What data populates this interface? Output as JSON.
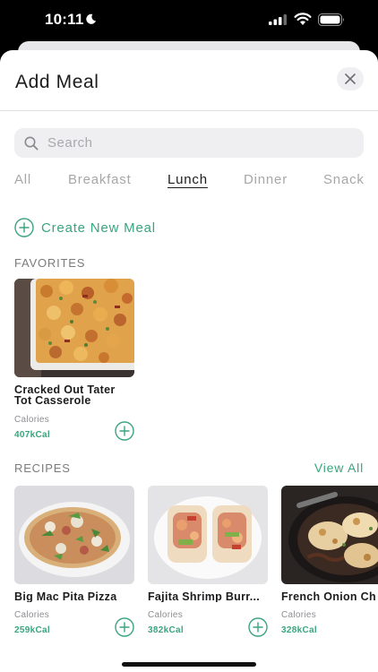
{
  "status_bar": {
    "time": "10:11"
  },
  "sheet": {
    "title": "Add Meal"
  },
  "search": {
    "placeholder": "Search"
  },
  "tabs": [
    {
      "label": "All",
      "active": false
    },
    {
      "label": "Breakfast",
      "active": false
    },
    {
      "label": "Lunch",
      "active": true
    },
    {
      "label": "Dinner",
      "active": false
    },
    {
      "label": "Snack",
      "active": false
    }
  ],
  "create_meal": {
    "label": "Create New Meal"
  },
  "favorites": {
    "heading": "FAVORITES",
    "items": [
      {
        "name": "Cracked Out Tater Tot Casserole",
        "calories_label": "Calories",
        "calories": "407kCal"
      }
    ]
  },
  "recipes": {
    "heading": "RECIPES",
    "view_all": "View All",
    "items": [
      {
        "name": "Big Mac Pita Pizza",
        "calories_label": "Calories",
        "calories": "259kCal"
      },
      {
        "name": "Fajita Shrimp Burr...",
        "calories_label": "Calories",
        "calories": "382kCal"
      },
      {
        "name": "French Onion Ch",
        "calories_label": "Calories",
        "calories": "328kCal"
      }
    ]
  },
  "colors": {
    "accent": "#3aa57e",
    "muted": "#a7a7a9",
    "search_bg": "#efeff1"
  }
}
